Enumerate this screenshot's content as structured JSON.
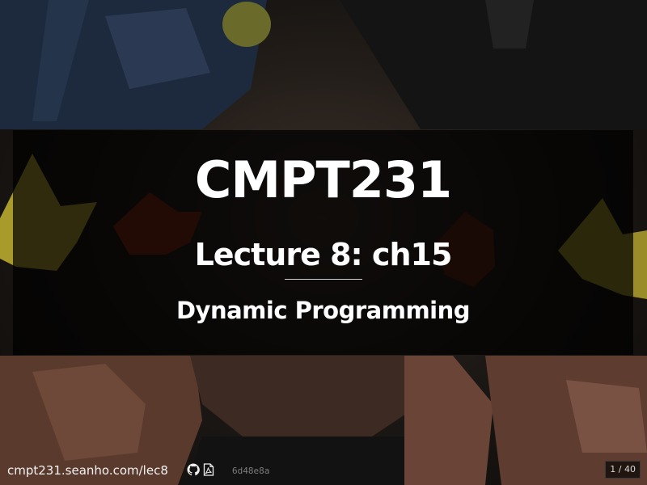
{
  "slide": {
    "course": "CMPT231",
    "lecture": "Lecture 8: ch15",
    "topic": "Dynamic Programming"
  },
  "footer": {
    "url": "cmpt231.seanho.com/lec8",
    "github_icon": "github-icon",
    "pdf_icon": "pdf-icon",
    "commit": "6d48e8a",
    "page": "1 / 40"
  },
  "colors": {
    "panel": "#000000b8",
    "text": "#ffffff",
    "hash": "#7c7c7c"
  }
}
